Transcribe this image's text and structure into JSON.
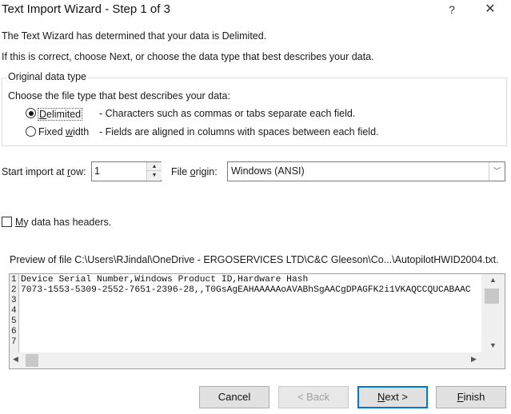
{
  "window": {
    "title": "Text Import Wizard - Step 1 of 3",
    "help_glyph": "?",
    "close_glyph": "✕"
  },
  "intro": {
    "line1": "The Text Wizard has determined that your data is Delimited.",
    "line2": "If this is correct, choose Next, or choose the data type that best describes your data."
  },
  "original_data_type": {
    "group_title": "Original data type",
    "prompt": "Choose the file type that best describes your data:",
    "options": [
      {
        "label": "Delimited",
        "description": "- Characters such as commas or tabs separate each field.",
        "selected": true
      },
      {
        "label": "Fixed width",
        "description": "- Fields are aligned in columns with spaces between each field.",
        "selected": false
      }
    ]
  },
  "import_settings": {
    "start_row_label": "Start import at row:",
    "start_row_value": "1",
    "file_origin_label": "File origin:",
    "file_origin_value": "Windows (ANSI)"
  },
  "headers_checkbox": {
    "label": "My data has headers.",
    "checked": false
  },
  "preview": {
    "label": "Preview of file C:\\Users\\RJindal\\OneDrive - ERGOSERVICES LTD\\C&C Gleeson\\Co...\\AutopilotHWID2004.txt.",
    "row_numbers": [
      "1",
      "2",
      "3",
      "4",
      "5",
      "6",
      "7"
    ],
    "lines": [
      "Device Serial Number,Windows Product ID,Hardware Hash",
      "7073-1553-5309-2552-7651-2396-28,,T0GsAgEAHAAAAAoAVABhSgAACgDPAGFK2i1VKAQCCQUCABAAC",
      "",
      "",
      "",
      "",
      ""
    ]
  },
  "buttons": {
    "cancel": "Cancel",
    "back": "< Back",
    "next": "Next >",
    "finish": "Finish"
  },
  "colors": {
    "default_button_border": "#0078d7",
    "button_face": "#e1e1e1"
  }
}
